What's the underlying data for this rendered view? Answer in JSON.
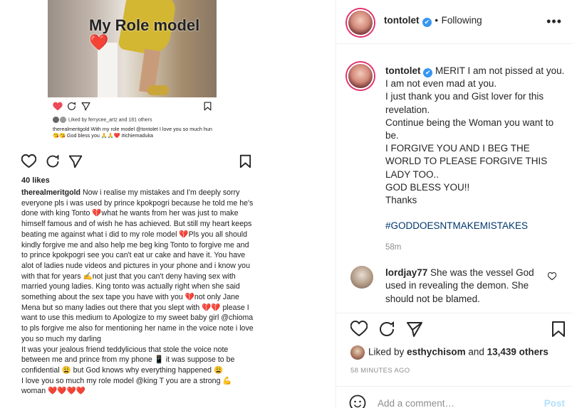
{
  "image_post": {
    "photo_caption": "My Role model",
    "photo_caption_heart": "❤️",
    "inner_liked": "Liked by ferrycee_artz and 181 others",
    "inner_caption": "therealmeritgold With my role model @tontolet I love you so much hun 😘😘 God bless you 🙏🙏❤️ #ichiemaduka",
    "likes": "40 likes",
    "caption_user": "therealmeritgold",
    "caption_text": "Now i realise my mistakes and I'm deeply sorry everyone pls i was used by prince kpokpogri because he told me he's done with king Tonto 💔what he wants from her was just to make himself famous and of wish he has achieved. But still  my heart keeps beating me against what i did to my role model 💔Pls you all should kindly forgive me and also help me beg king Tonto to forgive me and to prince kpokpogri see  you can't eat ur cake and have it. You have alot of ladies nude videos and pictures in your phone and i know you with that for years ✍️not just that you can't deny having sex with married young ladies. King tonto was actually right when she said something about the sex tape you have with you 💔not only Jane Mena but so many ladies out there that you slept with 💔💔 please I want to use this medium to Apologize to my sweet baby girl @chioma to pls forgive me also for mentioning her name in the voice note i love you so much my darling",
    "caption_text_2": "It was  your jealous friend teddylicious that stole the voice note between me and prince from my phone 📱 it was suppose to be confidential 😩 but God knows why everything happened 😩",
    "caption_text_3": "I love you so much my role model @king T you are a strong 💪 woman ❤️❤️❤️❤️"
  },
  "header": {
    "username": "tontolet",
    "verified_mark": "✔",
    "separator": "•",
    "following": "Following",
    "more": "•••"
  },
  "caption": {
    "username": "tontolet",
    "lines": [
      "MERIT I am not pissed at you. I am not even mad at you.",
      "I just thank you and Gist lover for this revelation.",
      "Continue being the Woman you want to be.",
      "I FORGIVE YOU AND I BEG THE WORLD TO PLEASE FORGIVE THIS LADY TOO..",
      "GOD BLESS YOU!!",
      "Thanks"
    ],
    "hashtag": "#GODDOESNTMAKEMISTAKES",
    "time": "58m"
  },
  "comment": {
    "username": "lordjay77",
    "text": "She was the vessel God used in revealing the demon. She should not be blamed."
  },
  "liked_by": {
    "prefix": "Liked by ",
    "user": "esthychisom",
    "middle": " and ",
    "count": "13,439 others"
  },
  "posted": "58 MINUTES AGO",
  "add_comment": {
    "placeholder": "Add a comment…",
    "post": "Post"
  },
  "icons": [
    "heart-icon",
    "comment-icon",
    "share-icon",
    "save-icon",
    "emoji-icon",
    "more-icon",
    "verified-icon"
  ],
  "colors": {
    "link": "#00376b",
    "muted": "#8e8e8e",
    "verified": "#3897f0",
    "post_disabled": "#b2dffc",
    "like_red": "#ed4956"
  }
}
